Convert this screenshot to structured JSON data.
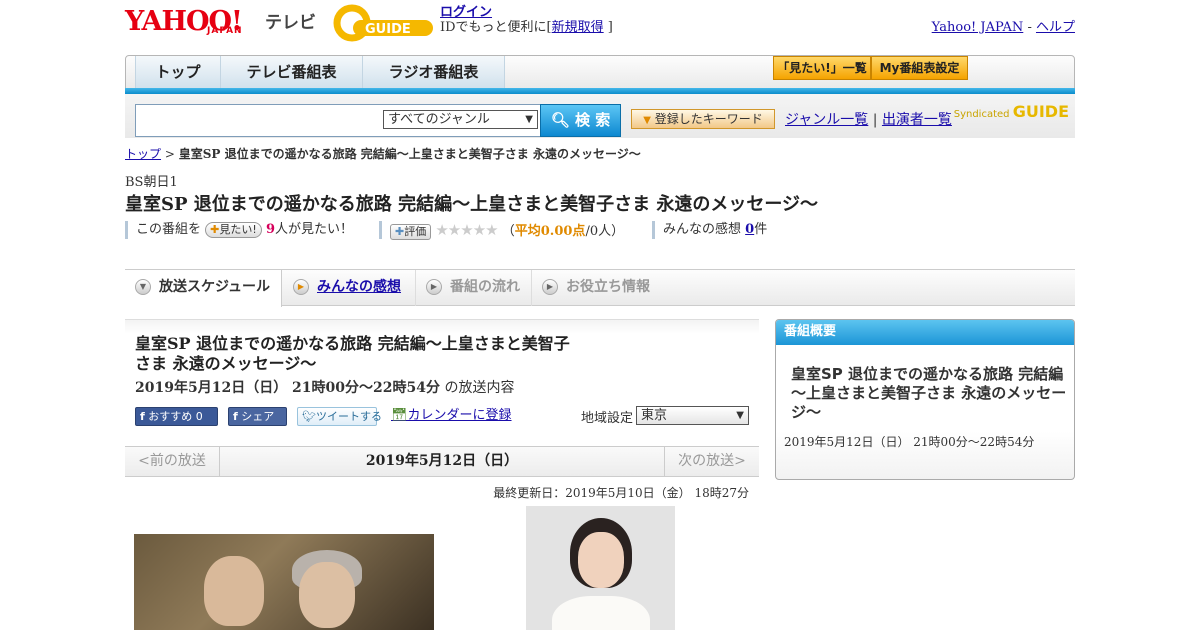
{
  "header": {
    "yahoo_logo": "YAHOO!",
    "yahoo_sub": "JAPAN",
    "tv_label": "テレビ",
    "gguide_logo": "GUIDE",
    "login": "ログイン",
    "login_text": "IDでもっと便利に[",
    "signup": "新規取得",
    "signup_close": "]",
    "yahoo_japan_link": "Yahoo! JAPAN",
    "separator": "-",
    "help_link": "ヘルプ"
  },
  "nav": {
    "tabs": [
      "トップ",
      "テレビ番組表",
      "ラジオ番組表"
    ],
    "mitai_list": "「見たい!」一覧",
    "my_schedule": "My番組表設定"
  },
  "search": {
    "query": "",
    "genre": "すべてのジャンル",
    "button": "検 索",
    "keyword_button": "登録したキーワード",
    "genre_list": "ジャンル一覧",
    "pipe": "|",
    "performer_list": "出演者一覧",
    "syndicated": "Syndicated",
    "syndicated_logo": "GUIDE"
  },
  "breadcrumb": {
    "top": "トップ",
    "sep": ">",
    "current": "皇室SP 退位までの遥かなる旅路 完結編～上皇さまと美智子さま 永遠のメッセージ～"
  },
  "program": {
    "channel": "BS朝日1",
    "title": "皇室SP 退位までの遥かなる旅路 完結編～上皇さまと美智子さま 永遠のメッセージ～",
    "mitai_prefix": "この番組を",
    "mitai_btn": "見たい!",
    "mitai_count": "9",
    "mitai_suffix": "人が見たい！",
    "rate_btn": "評価",
    "stars": "★★★★★",
    "avg_open": "（",
    "avg_label": "平均0.00点",
    "avg_people": "/0人）",
    "reviews_label": "みんなの感想",
    "reviews_count": "0",
    "reviews_unit": "件"
  },
  "content_tabs": [
    "放送スケジュール",
    "みんなの感想",
    "番組の流れ",
    "お役立ち情報"
  ],
  "broadcast": {
    "title": "皇室SP 退位までの遥かなる旅路 完結編～上皇さまと美智子さま 永遠のメッセージ～",
    "datetime": "2019年5月12日（日） 21時00分～22時54分",
    "datetime_suffix": "の放送内容",
    "fb_recommend": "おすすめ 0",
    "fb_share": "シェア",
    "tweet": "ツイートする",
    "calendar": "カレンダーに登録",
    "region_label": "地域設定",
    "region": "東京",
    "prev": "<前の放送",
    "current_day": "2019年5月12日（日）",
    "next": "次の放送>",
    "updated": "最終更新日：2019年5月10日（金） 18時27分"
  },
  "side": {
    "heading": "番組概要",
    "title": "皇室SP 退位までの遥かなる旅路 完結編～上皇さまと美智子さま 永遠のメッセージ～",
    "datetime": "2019年5月12日（日） 21時00分～22時54分"
  }
}
